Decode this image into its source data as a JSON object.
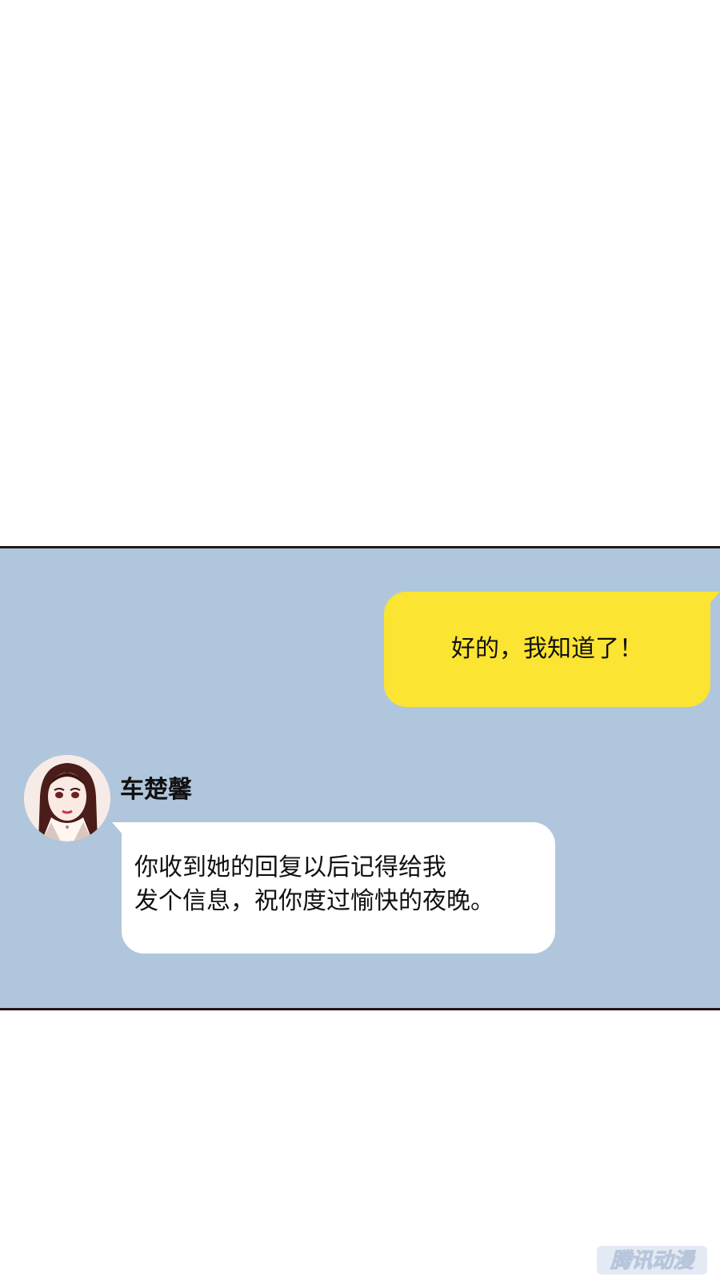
{
  "chat": {
    "outgoing_message": "好的，我知道了！",
    "sender_name": "车楚馨",
    "incoming_message_lines": [
      "你收到她的回复以后记得给我",
      "发个信息，祝你度过愉快的夜晚。"
    ]
  },
  "watermark": {
    "text": "腾讯动漫"
  },
  "colors": {
    "panel_bg": "#b0c6dc",
    "outgoing_bubble": "#fbe432",
    "incoming_bubble": "#ffffff",
    "panel_border": "#251616"
  }
}
